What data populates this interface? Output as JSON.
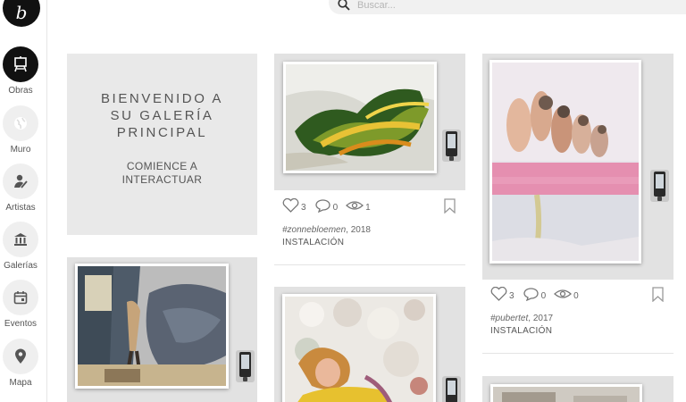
{
  "logo": {
    "letter": "b"
  },
  "search": {
    "placeholder": "Buscar..."
  },
  "sidebar": {
    "items": [
      {
        "label": "Obras",
        "icon": "easel-icon"
      },
      {
        "label": "Muro",
        "icon": "globe-icon"
      },
      {
        "label": "Artistas",
        "icon": "artist-icon"
      },
      {
        "label": "Galerías",
        "icon": "museum-icon"
      },
      {
        "label": "Eventos",
        "icon": "calendar-icon"
      },
      {
        "label": "Mapa",
        "icon": "map-pin-icon"
      }
    ]
  },
  "welcome": {
    "title_line1": "BIENVENIDO A",
    "title_line2": "SU GALERÍA",
    "title_line3": "PRINCIPAL",
    "sub_line1": "COMIENCE A",
    "sub_line2": "INTERACTUAR"
  },
  "works": [
    {
      "likes": "3",
      "comments": "0",
      "views": "1",
      "tag": "#zonnebloemen",
      "year": ", 2018",
      "kind": "INSTALACIÓN"
    },
    {
      "likes": "3",
      "comments": "0",
      "views": "0",
      "tag": "#pubertet",
      "year": ", 2017",
      "kind": "INSTALACIÓN"
    }
  ],
  "colors": {
    "active_nav": "#111111",
    "tile_bg": "#e2e2e2",
    "welcome_bg": "#e9e9e9",
    "pink_stripe": "#e58fb0"
  }
}
